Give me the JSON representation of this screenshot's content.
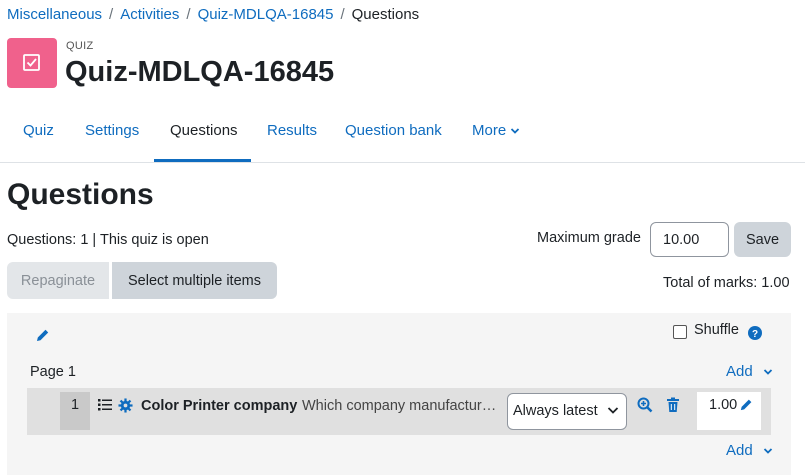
{
  "breadcrumb": {
    "items": [
      "Miscellaneous",
      "Activities",
      "Quiz-MDLQA-16845"
    ],
    "current": "Questions"
  },
  "activity": {
    "type": "QUIZ",
    "title": "Quiz-MDLQA-16845",
    "icon": "quiz-checkbox-icon",
    "icon_color": "#f0618c"
  },
  "nav": {
    "tabs": [
      "Quiz",
      "Settings",
      "Questions",
      "Results",
      "Question bank"
    ],
    "more": "More",
    "active": "Questions"
  },
  "page": {
    "heading": "Questions",
    "status": "Questions: 1 | This quiz is open",
    "max_grade_label": "Maximum grade",
    "max_grade_value": "10.00",
    "save": "Save",
    "repaginate": "Repaginate",
    "select_multiple": "Select multiple items",
    "total_marks": "Total of marks: 1.00"
  },
  "question_list": {
    "shuffle_label": "Shuffle",
    "page_label": "Page 1",
    "add": "Add",
    "questions": [
      {
        "slot": "1",
        "name": "Color Printer company",
        "text": "Which company manufactur…",
        "version": "Always latest",
        "mark": "1.00"
      }
    ]
  },
  "colors": {
    "link": "#0f6cbf",
    "panel_bg": "#f5f5f5",
    "row_bg": "#e0e0e0"
  }
}
